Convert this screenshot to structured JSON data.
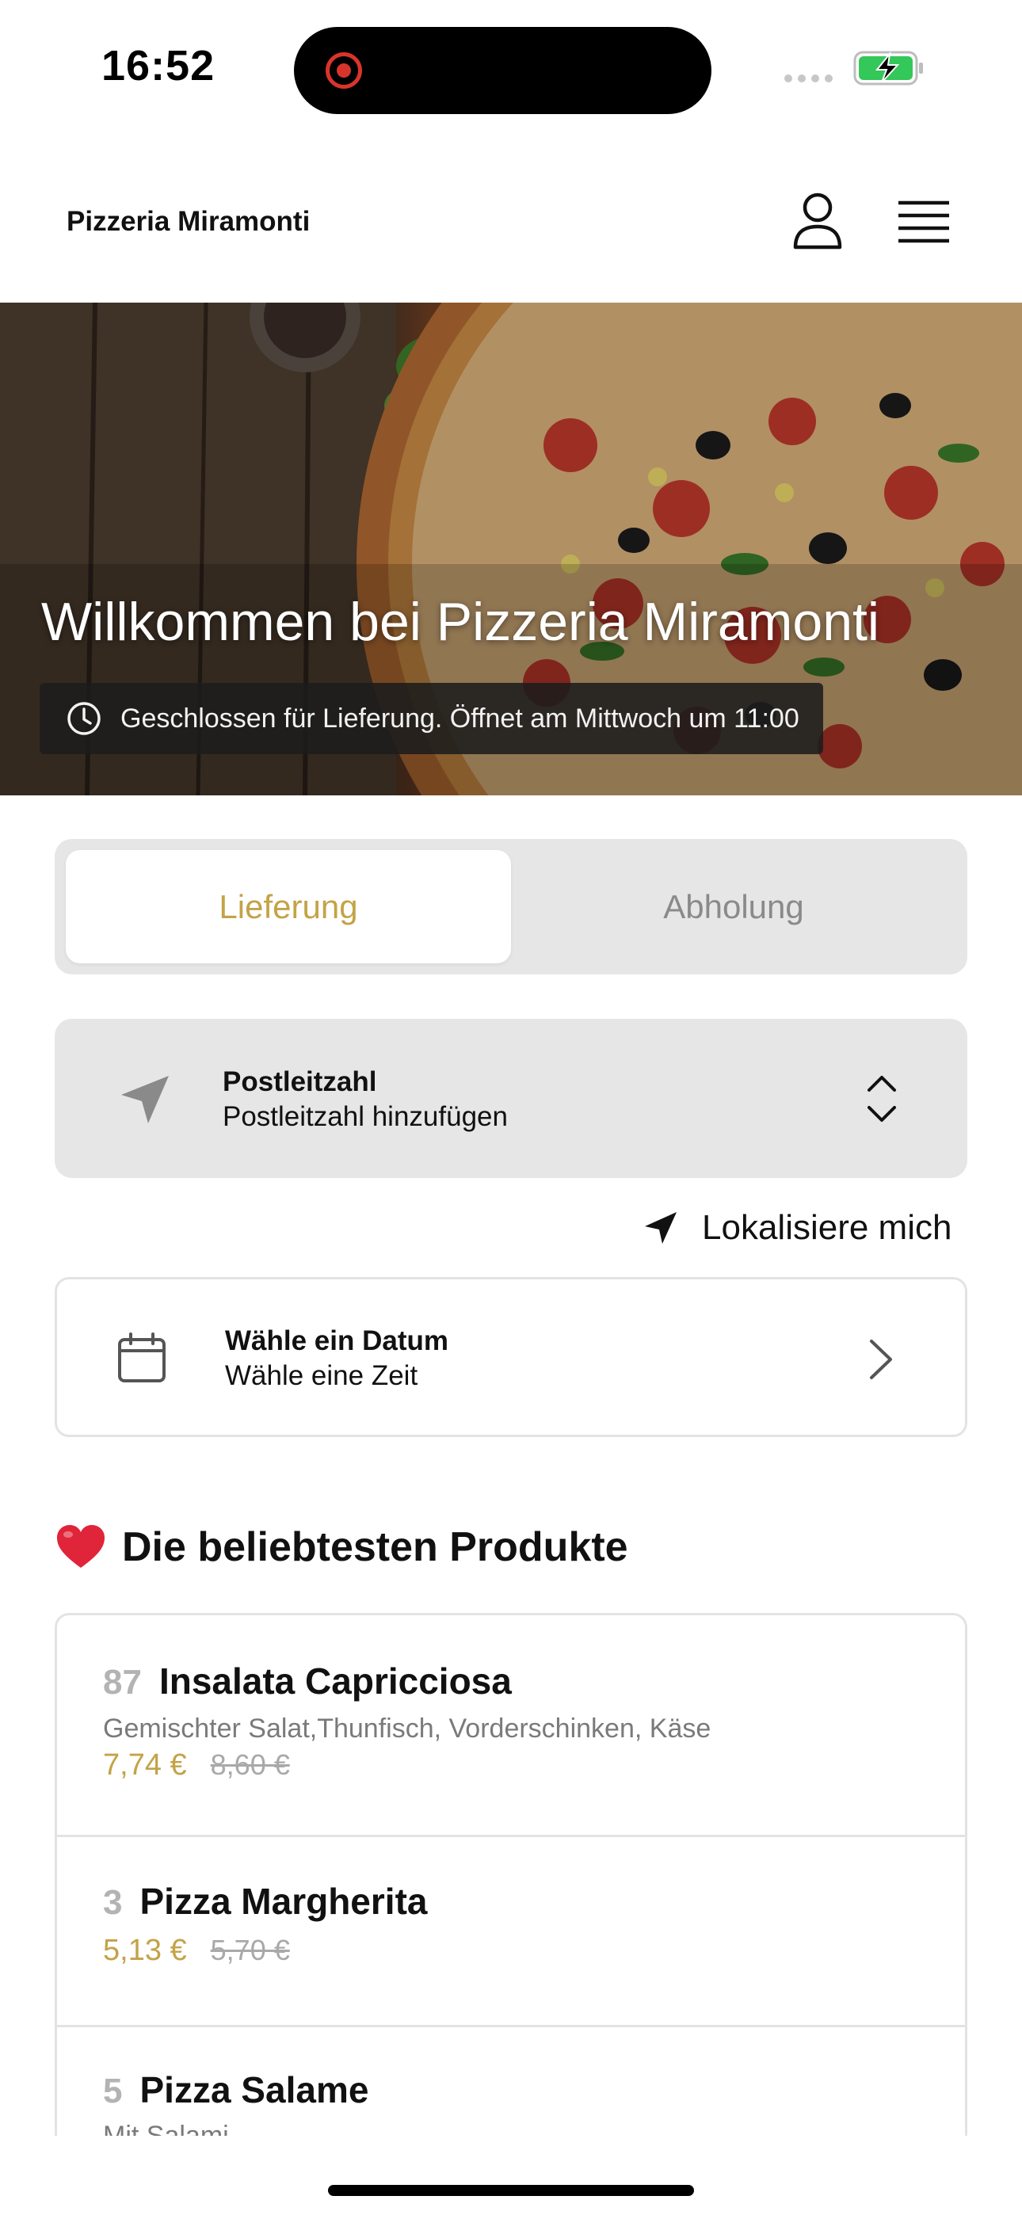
{
  "status_bar": {
    "time": "16:52"
  },
  "header": {
    "brand": "Pizzeria Miramonti"
  },
  "hero": {
    "title": "Willkommen bei Pizzeria Miramonti",
    "status": "Geschlossen für Lieferung. Öffnet am Mittwoch um 11:00"
  },
  "mode": {
    "delivery": "Lieferung",
    "pickup": "Abholung",
    "selected": "Lieferung"
  },
  "zip": {
    "title": "Postleitzahl",
    "subtitle": "Postleitzahl hinzufügen"
  },
  "locate": {
    "label": "Lokalisiere mich"
  },
  "date": {
    "title": "Wähle ein Datum",
    "subtitle": "Wähle eine Zeit"
  },
  "popular": {
    "title": "Die beliebtesten Produkte",
    "items": [
      {
        "number": "87",
        "name": "Insalata Capricciosa",
        "description": "Gemischter Salat,Thunfisch, Vorderschinken, Käse",
        "price": "7,74 €",
        "old_price": "8,60 €"
      },
      {
        "number": "3",
        "name": "Pizza Margherita",
        "price": "5,13 €",
        "old_price": "5,70 €"
      },
      {
        "number": "5",
        "name": "Pizza Salame",
        "description": "Mit Salami"
      }
    ]
  },
  "colors": {
    "accent": "#c3a347",
    "hero_overlay": "#1c1c1c",
    "card_bg": "#e6e6e6"
  }
}
